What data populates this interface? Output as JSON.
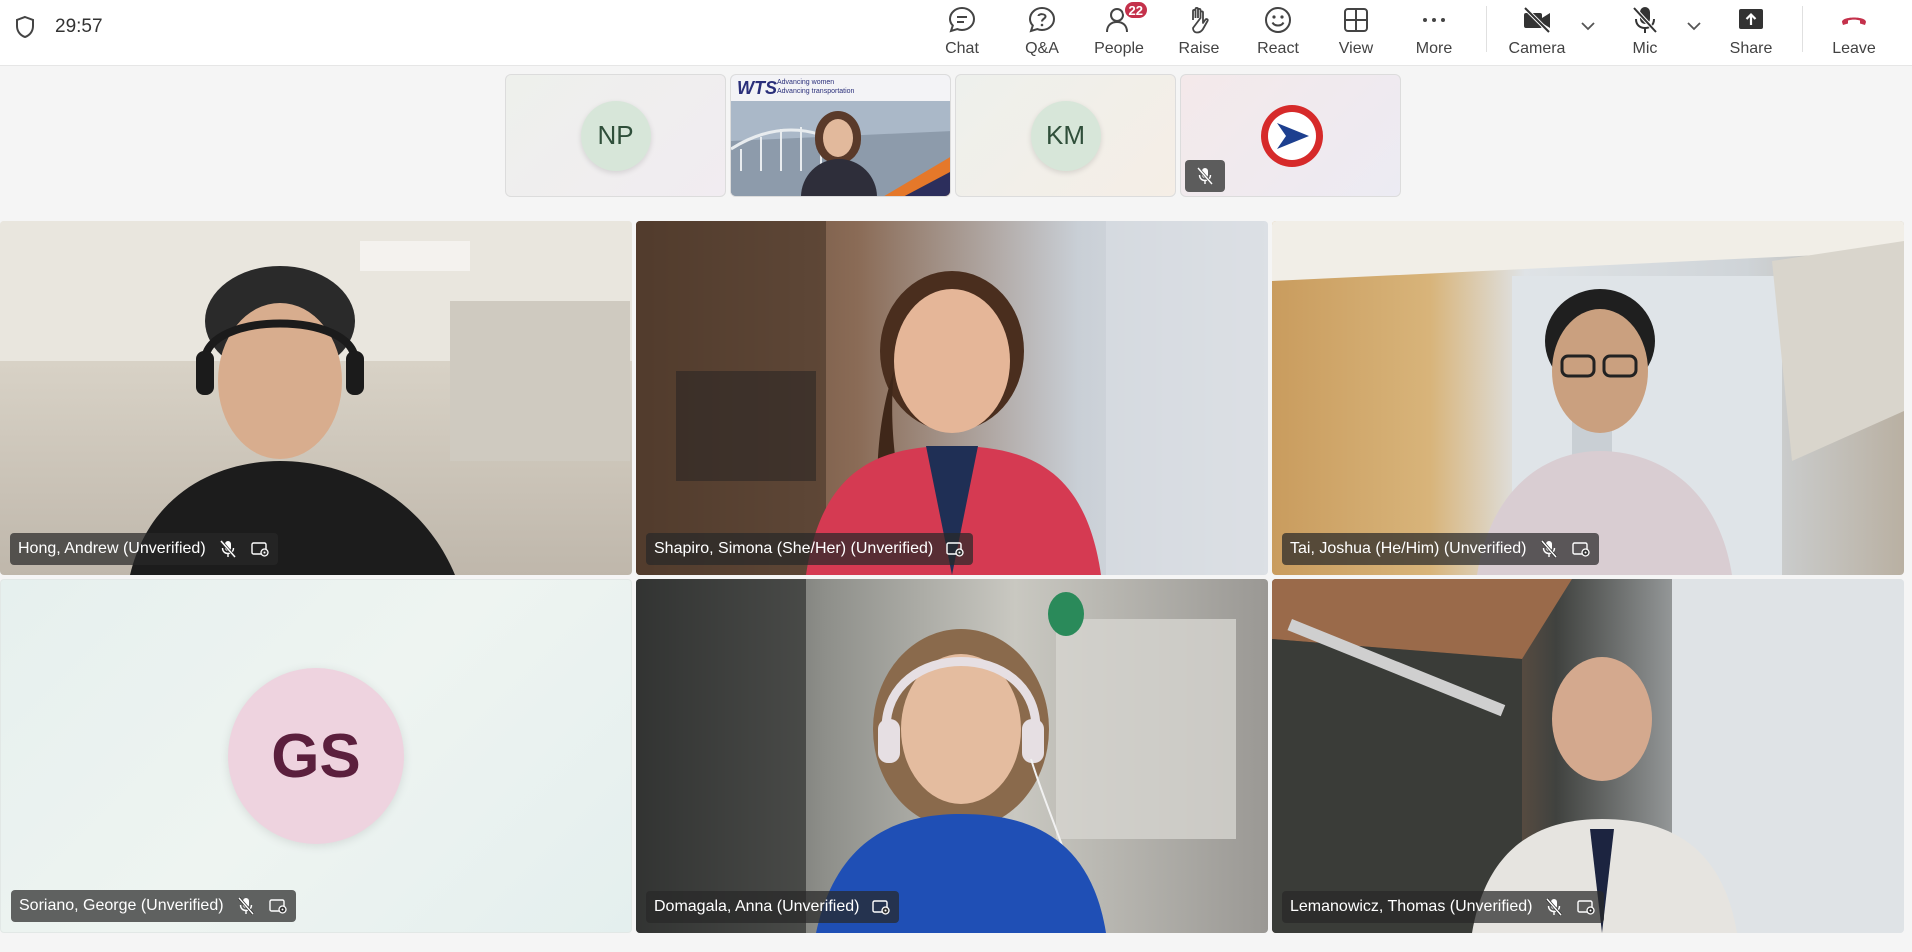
{
  "meeting": {
    "timer": "29:57"
  },
  "toolbar": {
    "chat": "Chat",
    "qa": "Q&A",
    "people": "People",
    "people_count": "22",
    "raise": "Raise",
    "react": "React",
    "view": "View",
    "more": "More",
    "camera": "Camera",
    "mic": "Mic",
    "share": "Share",
    "leave": "Leave"
  },
  "strip": [
    {
      "type": "initials",
      "initials": "NP"
    },
    {
      "type": "video",
      "banner_title": "WTS",
      "banner_line1": "Advancing women",
      "banner_line2": "Advancing transportation"
    },
    {
      "type": "initials",
      "initials": "KM"
    },
    {
      "type": "logo",
      "muted": true
    }
  ],
  "participants": [
    {
      "name": "Hong, Andrew (Unverified)",
      "muted": true
    },
    {
      "name": "Shapiro, Simona (She/Her) (Unverified)",
      "muted": false
    },
    {
      "name": "Tai, Joshua (He/Him) (Unverified)",
      "muted": true
    },
    {
      "name": "Soriano, George (Unverified)",
      "muted": true,
      "initials": "GS"
    },
    {
      "name": "Domagala, Anna (Unverified)",
      "muted": false
    },
    {
      "name": "Lemanowicz, Thomas (Unverified)",
      "muted": true
    }
  ],
  "colors": {
    "leave_red": "#c4314b",
    "badge_red": "#c4314b",
    "chip_bg": "rgba(40,40,40,0.72)"
  }
}
